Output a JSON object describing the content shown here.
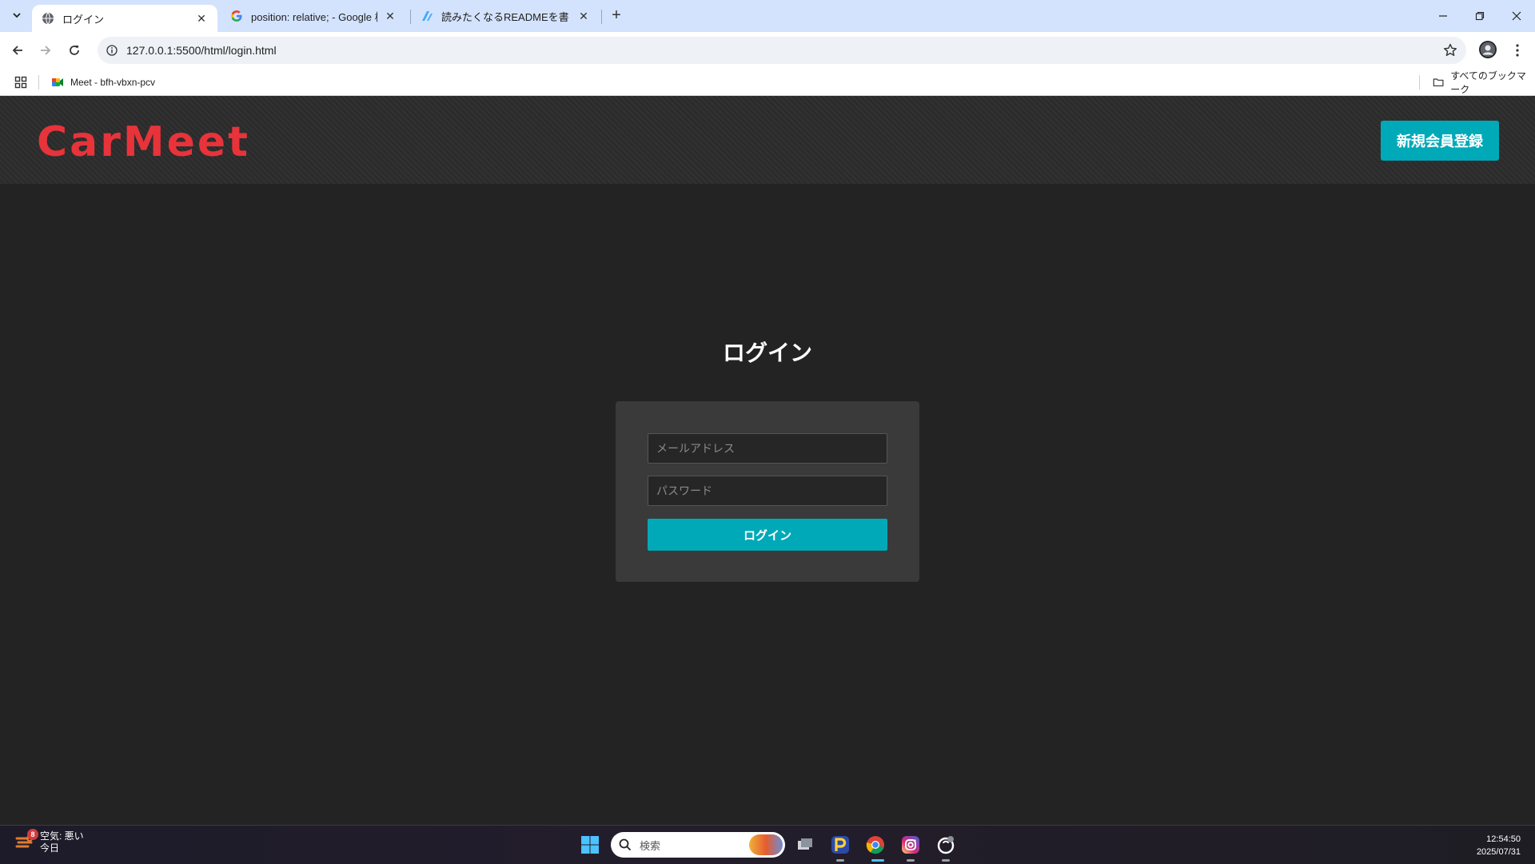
{
  "browser": {
    "tabs": [
      {
        "title": "ログイン",
        "active": true,
        "favicon": "globe-icon"
      },
      {
        "title": "position: relative; - Google 検索",
        "active": false,
        "favicon": "google-icon"
      },
      {
        "title": "読みたくなるREADMEを書くための",
        "active": false,
        "favicon": "zenn-icon"
      }
    ],
    "url": "127.0.0.1:5500/html/login.html",
    "bookmarks": [
      {
        "label": "Meet - bfh-vbxn-pcv",
        "icon": "google-meet-icon"
      }
    ],
    "all_bookmarks_label": "すべてのブックマーク"
  },
  "page": {
    "logo": "CarMeet",
    "register_button": "新規会員登録",
    "login_title": "ログイン",
    "email_placeholder": "メールアドレス",
    "password_placeholder": "パスワード",
    "login_button": "ログイン"
  },
  "colors": {
    "accent": "#00a9b8",
    "logo": "#e8333a",
    "background": "#232323",
    "card": "#3a3a3a"
  },
  "taskbar": {
    "weather_badge": "8",
    "weather_line1": "空気: 悪い",
    "weather_line2": "今日",
    "search_label": "検索",
    "time": "12:54:50",
    "date": "2025/07/31"
  }
}
